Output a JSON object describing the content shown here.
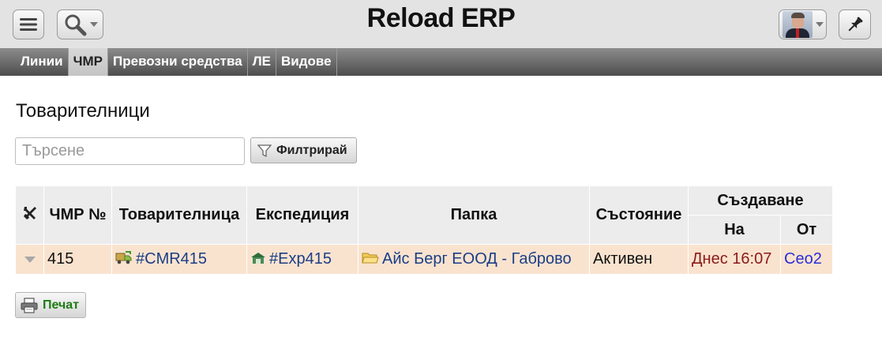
{
  "header": {
    "title": "Reload ERP",
    "menu_icon": "hamburger-menu-icon",
    "search_icon": "magnifier-icon",
    "pin_icon": "pushpin-icon"
  },
  "tabs": [
    {
      "label": "Линии",
      "active": false
    },
    {
      "label": "ЧМР",
      "active": true
    },
    {
      "label": "Превозни средства",
      "active": false
    },
    {
      "label": "ЛЕ",
      "active": false
    },
    {
      "label": "Видове",
      "active": false
    }
  ],
  "main": {
    "title": "Товарителници",
    "search": {
      "placeholder": "Търсене",
      "value": ""
    },
    "filter_label": "Филтрирай",
    "print_label": "Печат"
  },
  "table": {
    "headers": {
      "tools": "",
      "number": "ЧМР №",
      "waybill": "Товарителница",
      "expedition": "Експедиция",
      "folder": "Папка",
      "status": "Състояние",
      "created": "Създаване",
      "created_on": "На",
      "created_by": "От"
    },
    "rows": [
      {
        "number": "415",
        "waybill": "#CMR415",
        "expedition": "#Exp415",
        "folder": "Айс Берг ЕООД - Габрово",
        "status": "Активен",
        "created_on": "Днес 16:07",
        "created_by": "Ceo2"
      }
    ]
  },
  "colors": {
    "row_background": "#f9e3cf",
    "link": "#1a3e86",
    "date": "#8b1a1a",
    "user": "#2b2fd6",
    "print_text": "#1b7d14"
  }
}
